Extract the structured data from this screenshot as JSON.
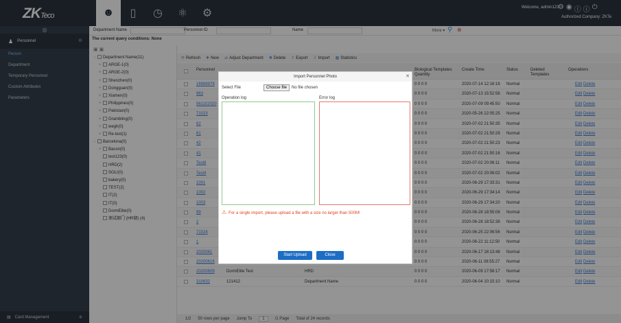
{
  "header": {
    "logo_main": "ZK",
    "logo_sub": "Teco",
    "welcome": "Welcome, admin123",
    "authorized": "Authorized Company: ZKTe"
  },
  "sidebar": {
    "module": "Personnel",
    "items": [
      {
        "label": "Person",
        "active": true
      },
      {
        "label": "Department",
        "active": false
      },
      {
        "label": "Temporary Personnel",
        "active": false
      },
      {
        "label": "Custom Attributes",
        "active": false
      },
      {
        "label": "Parameters",
        "active": false
      }
    ],
    "bottom": "Card Management"
  },
  "search": {
    "dept_label": "Department Name",
    "pin_label": "Personnel ID",
    "name_label": "Name",
    "more": "More",
    "query_conditions": "The current query conditions: None"
  },
  "tree": [
    {
      "label": "Department Name(11)",
      "depth": 0,
      "fold": "-"
    },
    {
      "label": "ARGE-1(0)",
      "depth": 1,
      "fold": "+"
    },
    {
      "label": "ARGE-2(0)",
      "depth": 1,
      "fold": "+"
    },
    {
      "label": "Shenzhen(0)",
      "depth": 1,
      "fold": "+"
    },
    {
      "label": "Dongguan(0)",
      "depth": 1,
      "fold": "+"
    },
    {
      "label": "Xiamen(0)",
      "depth": 1,
      "fold": "+"
    },
    {
      "label": "Philippines(0)",
      "depth": 1,
      "fold": "+"
    },
    {
      "label": "Pakistan(0)",
      "depth": 1,
      "fold": "+"
    },
    {
      "label": "Grambling(0)",
      "depth": 1,
      "fold": "+"
    },
    {
      "label": "wegh(0)",
      "depth": 1,
      "fold": "+"
    },
    {
      "label": "Re-test(1)",
      "depth": 1,
      "fold": "+"
    },
    {
      "label": "Barcelona(0)",
      "depth": 0,
      "fold": "-"
    },
    {
      "label": "Bacon(0)",
      "depth": 1,
      "fold": "+"
    },
    {
      "label": "test123(0)",
      "depth": 1,
      "fold": ""
    },
    {
      "label": "HRD(2)",
      "depth": 1,
      "fold": ""
    },
    {
      "label": "SOLI(0)",
      "depth": 1,
      "fold": ""
    },
    {
      "label": "bakery(0)",
      "depth": 1,
      "fold": ""
    },
    {
      "label": "TEST(2)",
      "depth": 1,
      "fold": ""
    },
    {
      "label": "IT(2)",
      "depth": 1,
      "fold": ""
    },
    {
      "label": "IT(0)",
      "depth": 1,
      "fold": ""
    },
    {
      "label": "DormElite(0)",
      "depth": 1,
      "fold": ""
    },
    {
      "label": "测试部门 (HR部) (4)",
      "depth": 1,
      "fold": ""
    }
  ],
  "toolbar": [
    {
      "label": "Refresh",
      "icon": "refresh-icon"
    },
    {
      "label": "New",
      "icon": "new-icon"
    },
    {
      "label": "Adjust Department",
      "icon": "adjust-icon"
    },
    {
      "label": "Delete",
      "icon": "delete-icon"
    },
    {
      "label": "Export",
      "icon": "export-icon"
    },
    {
      "label": "Import",
      "icon": "import-icon"
    },
    {
      "label": "Statistics",
      "icon": "statistics-icon"
    }
  ],
  "table": {
    "headers": {
      "pin": "Personnel",
      "templates": "Biological Templates Quantity",
      "create_time": "Create Time",
      "status": "Status",
      "deleted": "Deleted Templates",
      "operations": "Operations"
    },
    "rows": [
      {
        "pin": "16988978",
        "first": "",
        "last": "",
        "dept": "",
        "time": "2020-07-14 12:16:16",
        "status": "Normal"
      },
      {
        "pin": "963",
        "first": "",
        "last": "",
        "dept": "",
        "time": "2020-07-13 15:52:56",
        "status": "Normal"
      },
      {
        "pin": "561102020",
        "first": "",
        "last": "",
        "dept": "",
        "time": "2020-07-09 09:45:50",
        "status": "Normal"
      },
      {
        "pin": "71023",
        "first": "",
        "last": "",
        "dept": "",
        "time": "2020-05-26 22:05:25",
        "status": "Normal"
      },
      {
        "pin": "62",
        "first": "",
        "last": "",
        "dept": "",
        "time": "2020-07-02 21:50:35",
        "status": "Normal"
      },
      {
        "pin": "61",
        "first": "",
        "last": "",
        "dept": "",
        "time": "2020-07-02 21:50:29",
        "status": "Normal"
      },
      {
        "pin": "42",
        "first": "",
        "last": "",
        "dept": "",
        "time": "2020-07-02 21:50:23",
        "status": "Normal"
      },
      {
        "pin": "41",
        "first": "",
        "last": "",
        "dept": "",
        "time": "2020-07-02 21:50:16",
        "status": "Normal"
      },
      {
        "pin": "Test8",
        "first": "",
        "last": "",
        "dept": "",
        "time": "2020-07-02 20:06:11",
        "status": "Normal"
      },
      {
        "pin": "Test4",
        "first": "",
        "last": "",
        "dept": "",
        "time": "2020-07-02 20:06:02",
        "status": "Normal"
      },
      {
        "pin": "1001",
        "first": "",
        "last": "",
        "dept": "",
        "time": "2020-06-29 17:33:31",
        "status": "Normal"
      },
      {
        "pin": "1002",
        "first": "",
        "last": "",
        "dept": "",
        "time": "2020-06-29 17:34:14",
        "status": "Normal"
      },
      {
        "pin": "1003",
        "first": "",
        "last": "",
        "dept": "",
        "time": "2020-06-29 17:34:20",
        "status": "Normal"
      },
      {
        "pin": "99",
        "first": "",
        "last": "",
        "dept": "",
        "time": "2020-06-28 18:55:08",
        "status": "Normal"
      },
      {
        "pin": "2",
        "first": "",
        "last": "",
        "dept": "",
        "time": "2020-06-28 18:52:38",
        "status": "Normal"
      },
      {
        "pin": "71024",
        "first": "",
        "last": "",
        "dept": "",
        "time": "2020-06-25 22:06:56",
        "status": "Normal"
      },
      {
        "pin": "1",
        "first": "",
        "last": "",
        "dept": "Department Name",
        "time": "2020-06-22 11:12:50",
        "status": "Normal"
      },
      {
        "pin": "2020061",
        "first": "",
        "last": "",
        "dept": "Department Name",
        "time": "2020-06-17 16:13:48",
        "status": "Normal"
      },
      {
        "pin": "20200616",
        "first": "1",
        "last": "2",
        "dept": "Department Name",
        "time": "2020-06-11 08:55:27",
        "status": "Normal"
      },
      {
        "pin": "20200609",
        "first": "DormElite Test",
        "last": "",
        "dept": "HRD",
        "time": "2020-06-09 17:58:17",
        "status": "Normal"
      },
      {
        "pin": "310632",
        "first": "121412",
        "last": "",
        "dept": "Department Name",
        "time": "2020-06-04 10:15:10",
        "status": "Normal"
      }
    ],
    "templates": "0 0 0 0",
    "op_edit": "Edit",
    "op_delete": "Delete"
  },
  "pager": {
    "page": "1/2",
    "per_page": "50 rows per page",
    "jump": "Jump To",
    "page_input": "1",
    "page_suffix": "/1 Page",
    "total": "Total of 24 records"
  },
  "dialog": {
    "title": "Import Personnel Photo",
    "select_file": "Select File",
    "choose_file": "Choose file",
    "no_file": "No file chosen",
    "op_log": "Operation log",
    "error_log": "Error log",
    "warning": "For a single import, please upload a file with a size no larger than 500M!",
    "start_upload": "Start Upload",
    "close": "Close"
  },
  "colors": {
    "topbar": "#2c3440",
    "sidebar": "#36404c",
    "primary_button": "#1d6dc5",
    "op_log_border": "#8cc98c",
    "error_log_border": "#e8746b",
    "warning_text": "#e0401c"
  }
}
